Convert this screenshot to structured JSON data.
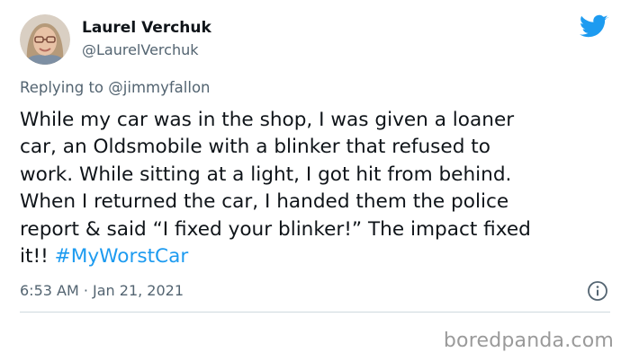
{
  "author": {
    "display_name": "Laurel Verchuk",
    "handle": "@LaurelVerchuk"
  },
  "reply_context": {
    "prefix": "Replying to ",
    "mention": "@jimmyfallon"
  },
  "tweet": {
    "lines": [
      "While my car was in the shop, I was given a loaner",
      "car, an Oldsmobile with a blinker that refused to",
      "work. While sitting at a light, I got hit from behind.",
      "When I returned the car, I handed them the police",
      "report & said “I fixed your blinker!”  The impact fixed"
    ],
    "last_line_text": "it!! ",
    "hashtag": "#MyWorstCar"
  },
  "timestamp": "6:53 AM · Jan 21, 2021",
  "watermark": "boredpanda.com",
  "icons": {
    "logo": "twitter-bird-icon",
    "info": "info-icon"
  },
  "colors": {
    "accent": "#1d9bf0",
    "text": "#0f1419",
    "secondary": "#536471",
    "watermark": "#9a9a9a"
  }
}
